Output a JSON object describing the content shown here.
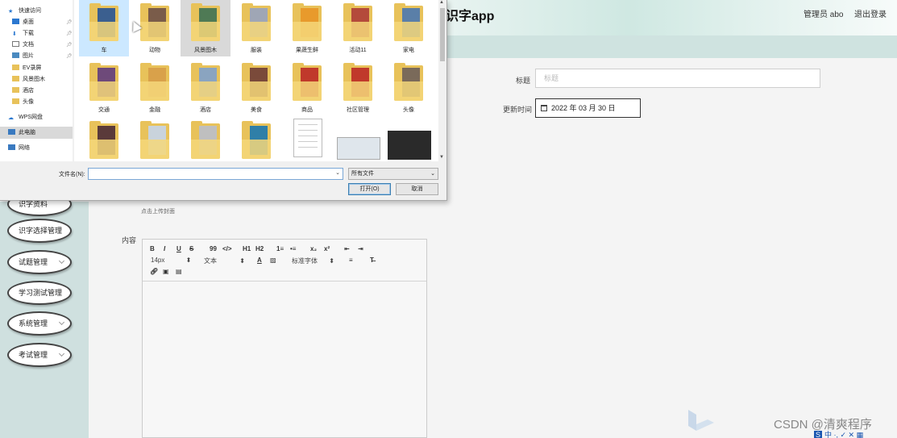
{
  "app": {
    "title": "识字app",
    "admin_label": "管理员 abo",
    "logout_label": "退出登录"
  },
  "sidebar": {
    "partial_item": "识字资料",
    "items": [
      {
        "label": "识字选择管理"
      },
      {
        "label": "试题管理"
      },
      {
        "label": "学习测试管理"
      },
      {
        "label": "系统管理"
      },
      {
        "label": "考试管理"
      }
    ]
  },
  "form": {
    "title_label": "标题",
    "title_placeholder": "标题",
    "updated_label": "更新时间",
    "updated_value": "2022 年 03 月 30 日",
    "upload_hint": "点击上传封面",
    "content_label": "内容"
  },
  "editor": {
    "row1": [
      "B",
      "I",
      "U",
      "S",
      "99",
      "</>",
      "H1",
      "H2",
      "1≡",
      "•≡",
      "x₂",
      "x²",
      "⇤",
      "⇥"
    ],
    "font_size": "14px",
    "text_style": "文本",
    "font_family": "标准字体"
  },
  "dialog": {
    "quick_access": "快速访问",
    "nav_items": [
      {
        "label": "桌面",
        "pinned": true
      },
      {
        "label": "下载",
        "pinned": true
      },
      {
        "label": "文档",
        "pinned": true
      },
      {
        "label": "图片",
        "pinned": true
      },
      {
        "label": "EV录屏",
        "pinned": false
      },
      {
        "label": "风景图木",
        "pinned": false
      },
      {
        "label": "酒店",
        "pinned": false
      },
      {
        "label": "头像",
        "pinned": false
      }
    ],
    "wps_label": "WPS网盘",
    "pc_label": "此电脑",
    "network_label": "网络",
    "folders": [
      {
        "label": "车",
        "color": "#3b5f8f"
      },
      {
        "label": "动物",
        "color": "#7a5c4a"
      },
      {
        "label": "风景图木",
        "color": "#4f7a55"
      },
      {
        "label": "服装",
        "color": "#9fa6b5"
      },
      {
        "label": "果蔬生鲜",
        "color": "#e89a2c"
      },
      {
        "label": "活动11",
        "color": "#b44a3b"
      },
      {
        "label": "家电",
        "color": "#5a7fa8"
      },
      {
        "label": "交通",
        "color": "#6e4a7a"
      },
      {
        "label": "金融",
        "color": "#d9a14a"
      },
      {
        "label": "酒店",
        "color": "#8aa4c0"
      },
      {
        "label": "美食",
        "color": "#7a4a3a"
      },
      {
        "label": "商品",
        "color": "#c0392b"
      },
      {
        "label": "社区管理",
        "color": "#c0392b"
      },
      {
        "label": "头像",
        "color": "#7a6a5a"
      },
      {
        "label": "",
        "color": "#5a3a3a"
      },
      {
        "label": "",
        "color": "#c9d3dc"
      },
      {
        "label": "",
        "color": "#bfbfbf"
      },
      {
        "label": "",
        "color": "#2f7fa8"
      }
    ],
    "filename_label": "文件名(N):",
    "filename_value": "",
    "filetype_value": "所有文件",
    "open_label": "打开(O)",
    "cancel_label": "取消"
  },
  "watermark": "CSDN @清爽程序",
  "tray_text": "中 ·, ✓ ✕ ▦"
}
